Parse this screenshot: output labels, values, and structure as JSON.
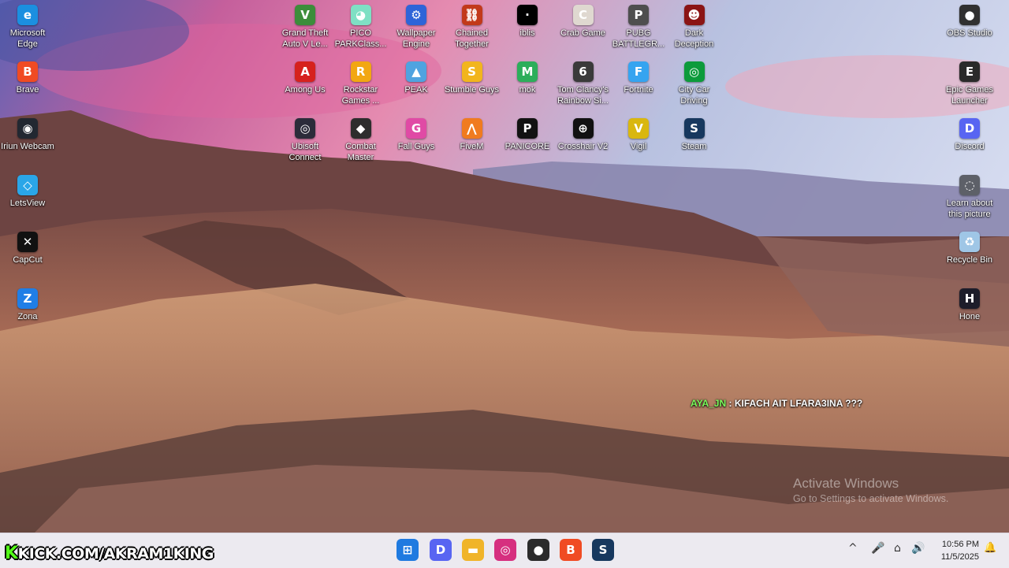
{
  "desktop_left": [
    {
      "label": "Microsoft Edge",
      "glyph": "e",
      "color": "#1b8fe0"
    },
    {
      "label": "Brave",
      "glyph": "B",
      "color": "#f04b23"
    },
    {
      "label": "Iriun Webcam",
      "glyph": "◉",
      "color": "#222831"
    },
    {
      "label": "LetsView",
      "glyph": "◇",
      "color": "#2aa6e8"
    },
    {
      "label": "CapCut",
      "glyph": "✕",
      "color": "#111111"
    },
    {
      "label": "Zona",
      "glyph": "Z",
      "color": "#1f7ee6"
    }
  ],
  "desktop_grid": [
    [
      {
        "label": "Grand Theft Auto V Le...",
        "glyph": "V",
        "color": "#3c8d3a"
      },
      {
        "label": "PICO PARKClass...",
        "glyph": "◕",
        "color": "#7fe0c4"
      },
      {
        "label": "Wallpaper Engine",
        "glyph": "⚙",
        "color": "#2e64d8"
      },
      {
        "label": "Chained Together",
        "glyph": "⛓",
        "color": "#c2391a"
      },
      {
        "label": "iblis",
        "glyph": "·",
        "color": "#000000"
      },
      {
        "label": "Crab Game",
        "glyph": "C",
        "color": "#dfd8d0"
      },
      {
        "label": "PUBG BATTLEGR...",
        "glyph": "P",
        "color": "#4e4e4e"
      },
      {
        "label": "Dark Deception",
        "glyph": "☻",
        "color": "#8b1414"
      }
    ],
    [
      {
        "label": "Among Us",
        "glyph": "A",
        "color": "#d6211d"
      },
      {
        "label": "Rockstar Games ...",
        "glyph": "R",
        "color": "#f2a712"
      },
      {
        "label": "PEAK",
        "glyph": "▲",
        "color": "#4fa3e0"
      },
      {
        "label": "Stumble Guys",
        "glyph": "S",
        "color": "#f2b51d"
      },
      {
        "label": "mok",
        "glyph": "M",
        "color": "#2cae5a"
      },
      {
        "label": "Tom Clancy's Rainbow Si...",
        "glyph": "6",
        "color": "#3a3a3a"
      },
      {
        "label": "Fortnite",
        "glyph": "F",
        "color": "#35a4f0"
      },
      {
        "label": "City Car Driving",
        "glyph": "◎",
        "color": "#0c9b3b"
      }
    ],
    [
      {
        "label": "Ubisoft Connect",
        "glyph": "◎",
        "color": "#2c2c3a"
      },
      {
        "label": "Combat Master",
        "glyph": "◆",
        "color": "#2d2d2d"
      },
      {
        "label": "Fall Guys",
        "glyph": "G",
        "color": "#e04aa5"
      },
      {
        "label": "FiveM",
        "glyph": "⋀",
        "color": "#f07b1f"
      },
      {
        "label": "PANICORE",
        "glyph": "P",
        "color": "#121212"
      },
      {
        "label": "Crosshair V2",
        "glyph": "⊕",
        "color": "#111111"
      },
      {
        "label": "Vigil",
        "glyph": "V",
        "color": "#d9b70f"
      },
      {
        "label": "Steam",
        "glyph": "S",
        "color": "#17385e"
      }
    ]
  ],
  "desktop_right": [
    {
      "label": "OBS Studio",
      "glyph": "●",
      "color": "#303030"
    },
    {
      "label": "Epic Games Launcher",
      "glyph": "E",
      "color": "#2a2a2a"
    },
    {
      "label": "Discord",
      "glyph": "D",
      "color": "#5865f2"
    },
    {
      "label": "Learn about this picture",
      "glyph": "◌",
      "color": "#5d6068"
    },
    {
      "label": "Recycle Bin",
      "glyph": "♻",
      "color": "#9fc6e6"
    },
    {
      "label": "Hone",
      "glyph": "H",
      "color": "#1d1d2a"
    }
  ],
  "chat": {
    "user": "AYA_JN",
    "message": ": KIFACH AIT LFARA3INA ???"
  },
  "watermark": {
    "line1": "Activate Windows",
    "line2": "Go to Settings to activate Windows."
  },
  "overlay": {
    "k": "K",
    "text": "KICK.COM/AKRAM1KING"
  },
  "taskbar": {
    "apps": [
      {
        "name": "start-button",
        "glyph": "⊞",
        "color": "#1f7ae0"
      },
      {
        "name": "discord-taskbar",
        "glyph": "D",
        "color": "#5865f2"
      },
      {
        "name": "file-explorer-taskbar",
        "glyph": "▬",
        "color": "#f0b429"
      },
      {
        "name": "instagram-taskbar",
        "glyph": "◎",
        "color": "#d62f7f"
      },
      {
        "name": "obs-taskbar",
        "glyph": "●",
        "color": "#2b2b2b"
      },
      {
        "name": "brave-taskbar",
        "glyph": "B",
        "color": "#f04b23"
      },
      {
        "name": "steam-taskbar",
        "glyph": "S",
        "color": "#17385e"
      }
    ],
    "tray": {
      "chevron": "^",
      "mic": "🎤",
      "network": "⌂",
      "volume": "🔊",
      "bell": "🔔"
    },
    "time": "10:56 PM",
    "date": "11/5/2025"
  }
}
